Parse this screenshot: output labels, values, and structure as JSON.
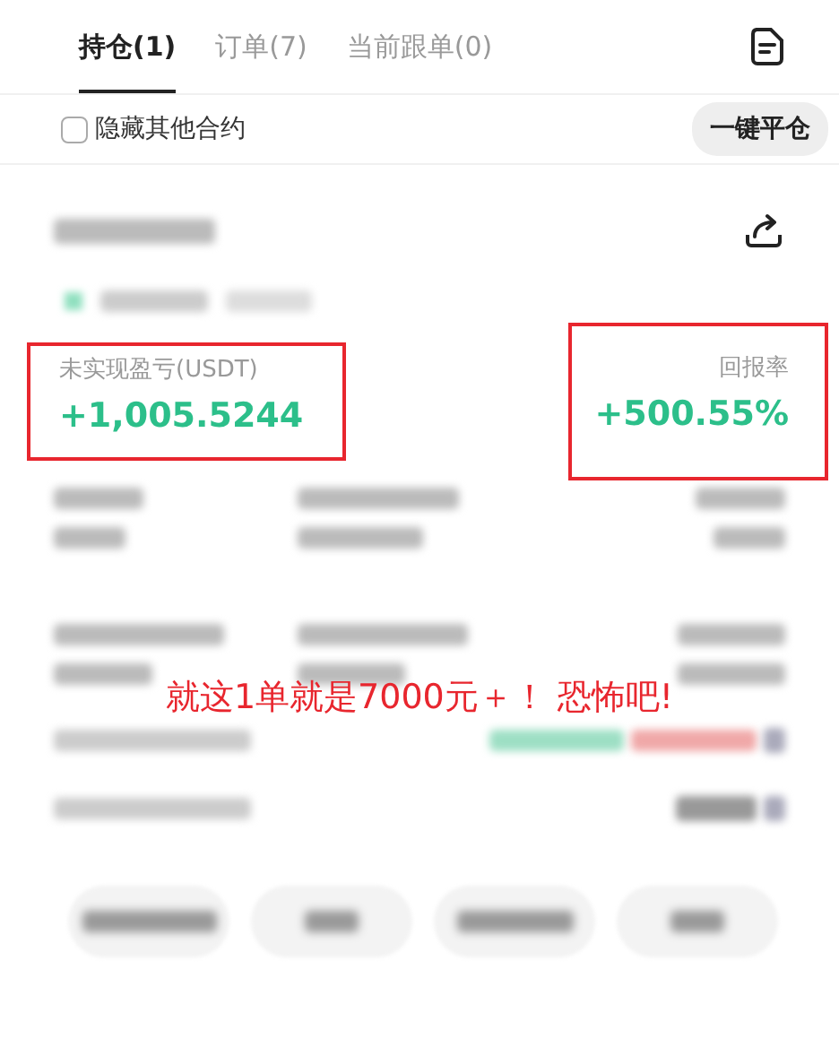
{
  "tabs": [
    {
      "label": "持仓(1)",
      "selected": true
    },
    {
      "label": "订单(7)",
      "selected": false
    },
    {
      "label": "当前跟单(0)",
      "selected": false
    }
  ],
  "filter": {
    "label": "隐藏其他合约",
    "checked": false
  },
  "close_all_button": "一键平仓",
  "stats": [
    {
      "label": "未实现盈亏(USDT)",
      "value": "+1,005.5244",
      "highlighted": true
    },
    {
      "label": "回报率",
      "value": "+500.55%",
      "highlighted": true
    }
  ],
  "annotation": "就这1单就是7000元＋！ 恐怖吧!"
}
